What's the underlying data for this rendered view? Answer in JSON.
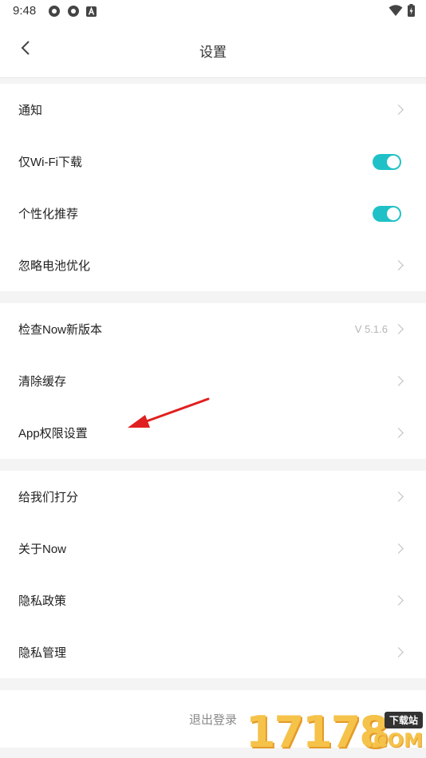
{
  "status_bar": {
    "time": "9:48",
    "icons": [
      "settings-cog-icon",
      "settings-cog-icon",
      "keyboard-a-icon"
    ],
    "right_icons": [
      "wifi-icon",
      "battery-charging-icon"
    ]
  },
  "app_bar": {
    "back_icon": "chevron-left-icon",
    "title": "设置"
  },
  "groups": [
    {
      "items": [
        {
          "label": "通知",
          "control": "chevron"
        },
        {
          "label": "仅Wi-Fi下载",
          "control": "toggle",
          "on": true
        },
        {
          "label": "个性化推荐",
          "control": "toggle",
          "on": true
        },
        {
          "label": "忽略电池优化",
          "control": "chevron"
        }
      ]
    },
    {
      "items": [
        {
          "label": "检查Now新版本",
          "control": "chevron",
          "value": "V 5.1.6"
        },
        {
          "label": "清除缓存",
          "control": "chevron"
        },
        {
          "label": "App权限设置",
          "control": "chevron"
        }
      ]
    },
    {
      "items": [
        {
          "label": "给我们打分",
          "control": "chevron"
        },
        {
          "label": "关于Now",
          "control": "chevron"
        },
        {
          "label": "隐私政策",
          "control": "chevron"
        },
        {
          "label": "隐私管理",
          "control": "chevron"
        }
      ]
    }
  ],
  "logout_label": "退出登录",
  "colors": {
    "toggle_on": "#1fc1c7",
    "annotation_arrow": "#e02020",
    "page_bg": "#f4f4f4"
  },
  "watermark": {
    "digits": "17178",
    "badge": "下载站",
    "domain": ".COM"
  }
}
